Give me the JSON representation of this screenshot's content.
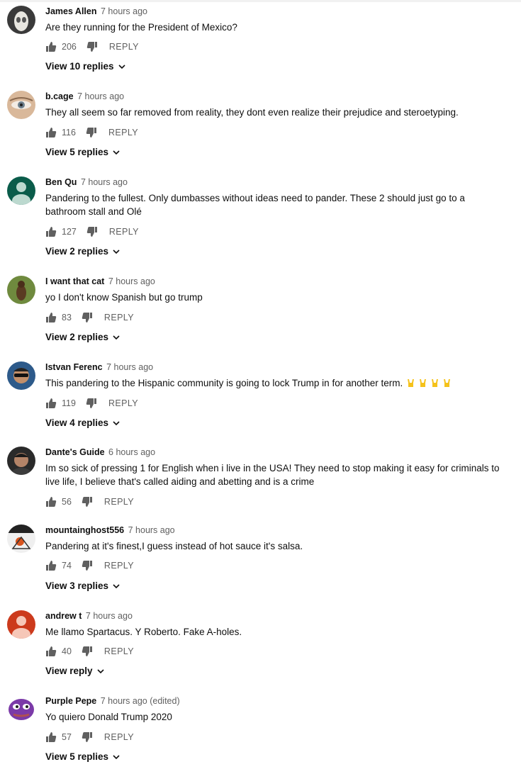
{
  "comments": [
    {
      "author": "James Allen",
      "time": "7 hours ago",
      "text": "Are they running for the President of Mexico?",
      "likes": "206",
      "reply": "REPLY",
      "replies": "View 10 replies",
      "avatar": "white-skull-avatar"
    },
    {
      "author": "b.cage",
      "time": "7 hours ago",
      "text": "They all seem so far removed from reality, they dont even realize their prejudice and steroetyping.",
      "likes": "116",
      "reply": "REPLY",
      "replies": "View 5 replies",
      "avatar": "eye-avatar"
    },
    {
      "author": "Ben Qu",
      "time": "7 hours ago",
      "text": "Pandering to the fullest. Only dumbasses without ideas need to pander. These 2 should just go to a bathroom stall and Olé",
      "likes": "127",
      "reply": "REPLY",
      "replies": "View 2 replies",
      "avatar": "default-teal-avatar"
    },
    {
      "author": "I want that cat",
      "time": "7 hours ago",
      "text": "yo I don't know Spanish but go trump",
      "likes": "83",
      "reply": "REPLY",
      "replies": "View 2 replies",
      "avatar": "cat-avatar"
    },
    {
      "author": "Istvan Ferenc",
      "time": "7 hours ago",
      "text": "This pandering to the Hispanic community is going to lock Trump in for another term.",
      "likes": "119",
      "reply": "REPLY",
      "replies": "View 4 replies",
      "avatar": "sunglasses-avatar"
    },
    {
      "author": "Dante's Guide",
      "time": "6 hours ago",
      "text": "Im so sick of pressing 1 for English when i live in the USA! They need to stop making it easy for criminals to live life, I believe that's called aiding and abetting and is a crime",
      "likes": "56",
      "reply": "REPLY",
      "replies": "",
      "avatar": "man-avatar"
    },
    {
      "author": "mountainghost556",
      "time": "7 hours ago",
      "text": "Pandering at it's finest,I guess instead of hot sauce it's salsa.",
      "likes": "74",
      "reply": "REPLY",
      "replies": "View 3 replies",
      "avatar": "drawing-avatar"
    },
    {
      "author": "andrew t",
      "time": "7 hours ago",
      "text": "Me llamo Spartacus. Y Roberto. Fake A-holes.",
      "likes": "40",
      "reply": "REPLY",
      "replies": "View reply",
      "avatar": "default-red-avatar"
    },
    {
      "author": "Purple Pepe",
      "time": "7 hours ago (edited)",
      "text": "Yo quiero Donald Trump 2020",
      "likes": "57",
      "reply": "REPLY",
      "replies": "View 5 replies",
      "avatar": "purple-frog-avatar"
    }
  ],
  "colors": {
    "text": "#0f0f0f",
    "meta": "#606060",
    "teal": "#0a5c4a",
    "red": "#cc3a1c",
    "purple": "#7b3aa8"
  },
  "icons": {
    "like": "thumbs-up-icon",
    "dislike": "thumbs-down-icon",
    "chevron": "chevron-down-icon",
    "emoji": "horns-hand-emoji"
  }
}
